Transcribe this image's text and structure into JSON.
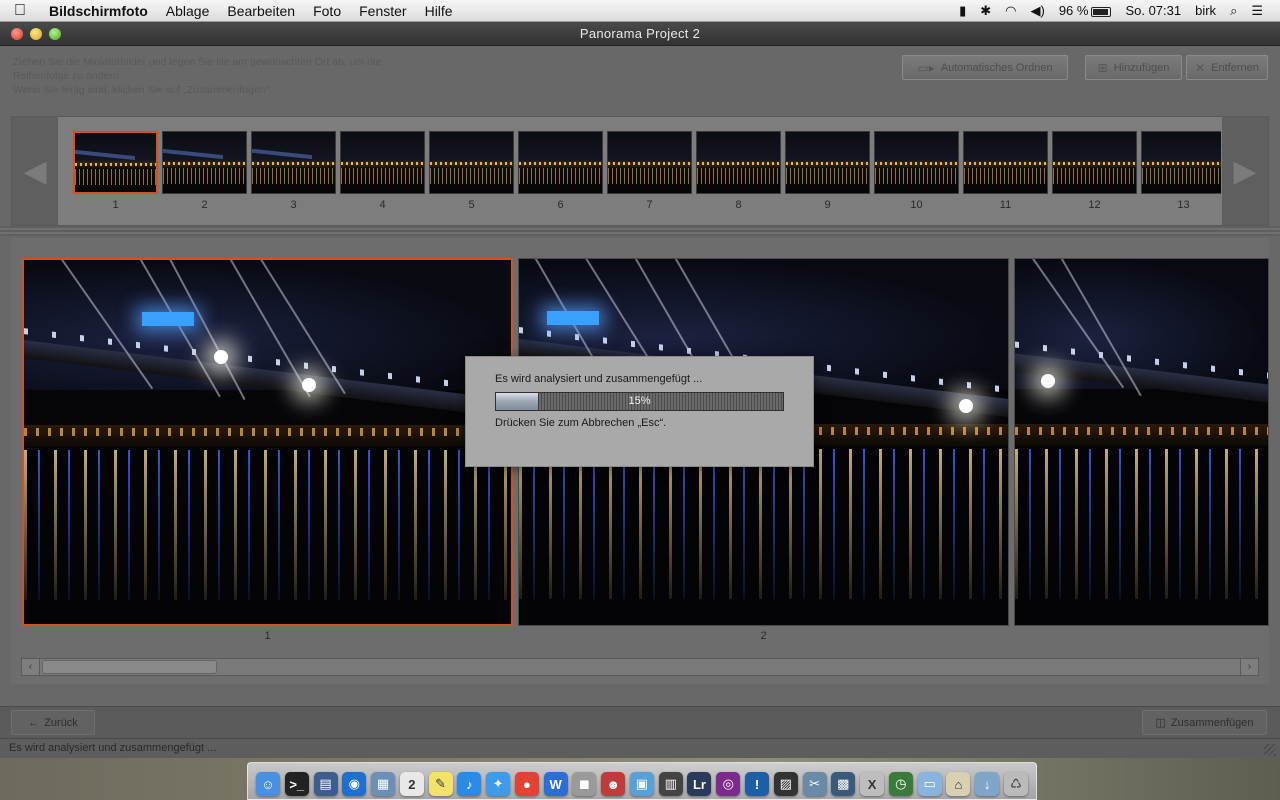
{
  "menubar": {
    "apple_icon": "apple-icon",
    "items": [
      "Bildschirmfoto",
      "Ablage",
      "Bearbeiten",
      "Foto",
      "Fenster",
      "Hilfe"
    ],
    "battery": "96 %",
    "clock": "So. 07:31",
    "user": "birk"
  },
  "window": {
    "title": "Panorama Project 2",
    "instructions": "Ziehen Sie die Miniaturbilder und legen Sie sie am gewünschten Ort ab, um die Reihenfolge zu ändern.\nWenn Sie fertig sind, klicken Sie auf „Zusammenfügen“.",
    "buttons": {
      "auto_arrange": "Automatisches Ordnen",
      "add": "Hinzufügen",
      "remove": "Entfernen"
    }
  },
  "thumbnails": [
    "1",
    "2",
    "3",
    "4",
    "5",
    "6",
    "7",
    "8",
    "9",
    "10",
    "11",
    "12",
    "13"
  ],
  "main_photos": {
    "photo1_label": "1",
    "photo2_label": "2"
  },
  "dialog": {
    "message": "Es wird analysiert und zusammengefügt ...",
    "progress_label": "15%",
    "progress_value": 0.15,
    "hint": "Drücken Sie zum Abbrechen „Esc“."
  },
  "bottom": {
    "back": "Zurück",
    "merge": "Zusammenfügen",
    "status": "Es wird analysiert und zusammengefügt ..."
  },
  "colors": {
    "selection": "#d8501f",
    "window_bg": "#686868"
  },
  "dock_icons": [
    "finder-icon",
    "terminal-icon",
    "chart-icon",
    "safari-icon",
    "preview-icon",
    "calendar-icon",
    "notes-icon",
    "itunes-icon",
    "safari-compass-icon",
    "chrome-icon",
    "word-icon",
    "camera-icon",
    "photo-booth-icon",
    "iphoto-icon",
    "film-icon",
    "lightroom-icon",
    "aperture-icon",
    "ichat-icon",
    "photos-icon",
    "image-capture-icon",
    "photoshop-icon",
    "x11-icon",
    "time-machine-icon",
    "folder-icon",
    "home-folder-icon",
    "downloads-icon",
    "trash-icon"
  ]
}
